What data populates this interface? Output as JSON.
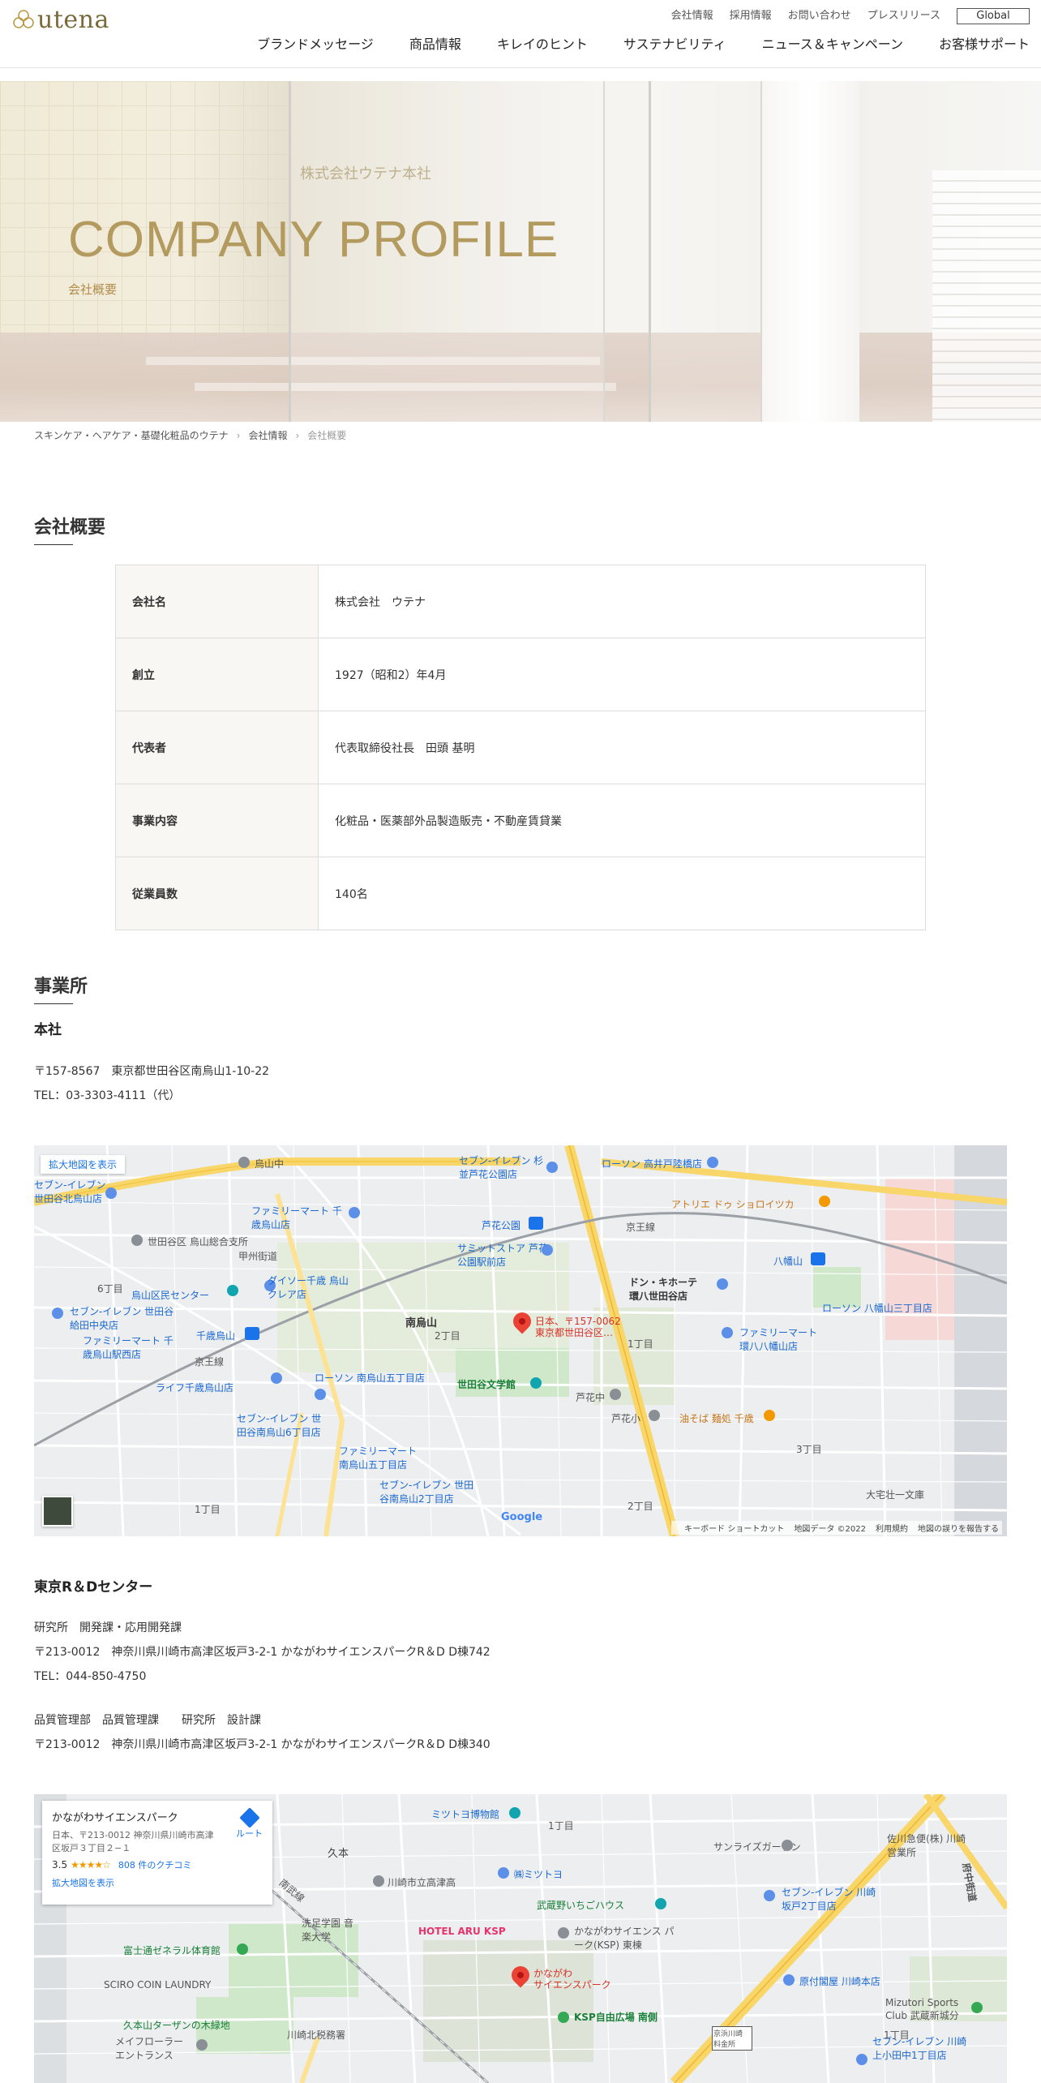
{
  "header": {
    "logo_text": "utena",
    "util_links": [
      "会社情報",
      "採用情報",
      "お問い合わせ",
      "プレスリリース"
    ],
    "global_label": "Global",
    "nav": [
      "ブランドメッセージ",
      "商品情報",
      "キレイのヒント",
      "サステナビリティ",
      "ニュース＆キャンペーン",
      "お客様サポート"
    ]
  },
  "hero": {
    "sign": "株式会社ウテナ本社",
    "title": "COMPANY PROFILE",
    "subtitle": "会社概要"
  },
  "breadcrumb": [
    "スキンケア・ヘアケア・基礎化粧品のウテナ",
    "会社情報",
    "会社概要"
  ],
  "profile": {
    "title": "会社概要",
    "rows": [
      {
        "label": "会社名",
        "value": "株式会社　ウテナ"
      },
      {
        "label": "創立",
        "value": "1927（昭和2）年4月"
      },
      {
        "label": "代表者",
        "value": "代表取締役社長　田頭 基明"
      },
      {
        "label": "事業内容",
        "value": "化粧品・医薬部外品製造販売・不動産賃貸業"
      },
      {
        "label": "従業員数",
        "value": "140名"
      }
    ]
  },
  "offices": {
    "title": "事業所",
    "hq": {
      "name": "本社",
      "address": "〒157-8567　東京都世田谷区南烏山1-10-22",
      "tel": "TEL：03-3303-4111（代）"
    },
    "rd": {
      "name": "東京R＆Dセンター",
      "dept1": "研究所　開発課・応用開発課",
      "address1": "〒213-0012　神奈川県川崎市高津区坂戸3-2-1 かながわサイエンスパークR＆D D棟742",
      "tel": "TEL：044-850-4750",
      "dept2": "品質管理部　品質管理課　　研究所　設計課",
      "address2": "〒213-0012　神奈川県川崎市高津区坂戸3-2-1 かながわサイエンスパークR＆D D棟340"
    }
  },
  "map1": {
    "enlarge": "拡大地図を表示",
    "pin_label_1": "日本、〒157-0062",
    "pin_label_2": "東京都世田谷区…",
    "google": "Google",
    "footer": [
      "キーボード ショートカット",
      "地図データ ©2022",
      "利用規約",
      "地図の誤りを報告する"
    ],
    "labels": {
      "karasuyama_naka": "烏山中",
      "seven_kitakarasuyama": "セブン-イレブン 世田谷北烏山店",
      "familymart_sengawa": "ファミリーマート 千歳烏山店",
      "setagaya_branch": "世田谷区 烏山総合支所",
      "daiso": "ダイソー千歳 烏山クレア店",
      "kumin_center": "烏山区民センター",
      "seven_kyuden": "セブン-イレブン 世田谷給田中央店",
      "familymart_eki": "ファミリーマート 千歳烏山駅西店",
      "chitose_st": "千歳烏山",
      "lawson_5": "ローソン 南烏山五丁目店",
      "life": "ライフ千歳烏山店",
      "seven_minami6": "セブン-イレブン 世田谷南烏山6丁目店",
      "familymart_5": "ファミリーマート 南烏山五丁目店",
      "seven_minami2": "セブン-イレブン 世田谷南烏山2丁目店",
      "minami_karasuyama": "南烏山",
      "chome2": "2丁目",
      "chome1": "1丁目",
      "chome6": "6丁目",
      "chome3": "3丁目",
      "bungakukan": "世田谷文学館",
      "rokakoen": "芦花公園",
      "summit": "サミットストア 芦花公園駅前店",
      "lawson_takaido": "ローソン 高井戸陸橋店",
      "seven_kamitakaido": "セブン-イレブン 杉並芦花公園店",
      "donki": "ドン・キホーテ 環八世田谷店",
      "hachimanyama": "八幡山",
      "lawson_hachiman": "ローソン 八幡山三丁目店",
      "familymart_hachiman": "ファミリーマート 環八八幡山店",
      "atelier": "アトリエ ドゥ ショロイツカ",
      "aburasoba": "油そば 麺処 千歳",
      "rokanaka": "芦花中",
      "rokasho": "芦花小",
      "keio": "京王線",
      "koshu": "甲州街道",
      "daitaku": "大宅壮一文庫"
    }
  },
  "map2": {
    "card_name": "かながわサイエンスパーク",
    "card_address": "日本、〒213-0012 神奈川県川崎市高津区坂戸３丁目２−１",
    "card_score": "3.5",
    "card_stars": "★★★★☆",
    "card_reviews": "808 件のクチコミ",
    "card_link": "拡大地図を表示",
    "card_route": "ルート",
    "pin_label_1": "かながわ",
    "pin_label_2": "サイエンスパーク",
    "labels": {
      "hisamoto": "久本",
      "mitsutoyo_museum": "ミツトヨ博物館",
      "chome1": "1丁目",
      "sunrise": "サンライズガーデン",
      "sagawa": "佐川急便(株) 川崎営業所",
      "kawasaki_high": "川崎市立高津高",
      "mitsutoyo": "㈱ミツトヨ",
      "bukou": "武蔵野いちごハウス",
      "seven_sakado": "セブン-イレブン 川崎坂戸2丁目店",
      "senzoku": "洗足学園 音楽大学",
      "fujishi": "富士通ゼネラル体育館",
      "hotel": "HOTEL ARU KSP",
      "ksp_east": "かながわサイエンス パーク(KSP) 東棟",
      "genkotsu": "原付閣屋 川崎本店",
      "sciro": "SCIRO COIN LAUNDRY",
      "ksp_plaza": "KSP自由広場 南側",
      "mizutori": "Mizutori Sports Club 武蔵新城分",
      "hisamoto_park": "久本山ターザンの木緑地",
      "mayfair": "メイフローラー エントランス",
      "zeimu": "川崎北税務署",
      "tollgate": "京浜川崎 料金所",
      "seven_kamiodanaka": "セブン-イレブン 川崎 上小田中1丁目店",
      "chome1b": "1丁目",
      "fuchu": "府中街道",
      "nambu": "南武線"
    }
  }
}
